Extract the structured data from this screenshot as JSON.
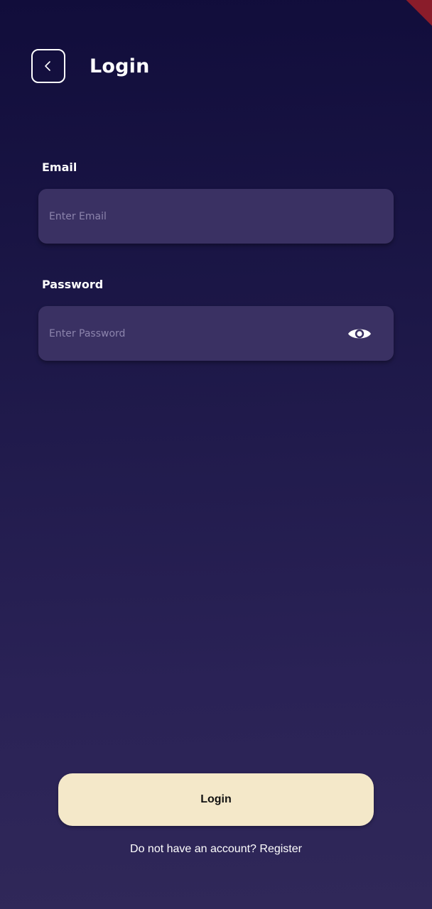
{
  "header": {
    "title": "Login",
    "back_icon": "chevron-left-icon"
  },
  "debug_banner": {
    "color": "#8a1c2a"
  },
  "form": {
    "email": {
      "label": "Email",
      "placeholder": "Enter Email",
      "value": ""
    },
    "password": {
      "label": "Password",
      "placeholder": "Enter Password",
      "value": "",
      "toggle_icon": "eye-icon"
    }
  },
  "actions": {
    "login_label": "Login",
    "register_prompt": "Do not have an account?",
    "register_label": "Register"
  },
  "colors": {
    "background_top": "#110d3b",
    "background_bottom": "#302859",
    "field_bg": "#3a3163",
    "button_bg": "#f4e8c9",
    "button_text": "#111111"
  }
}
